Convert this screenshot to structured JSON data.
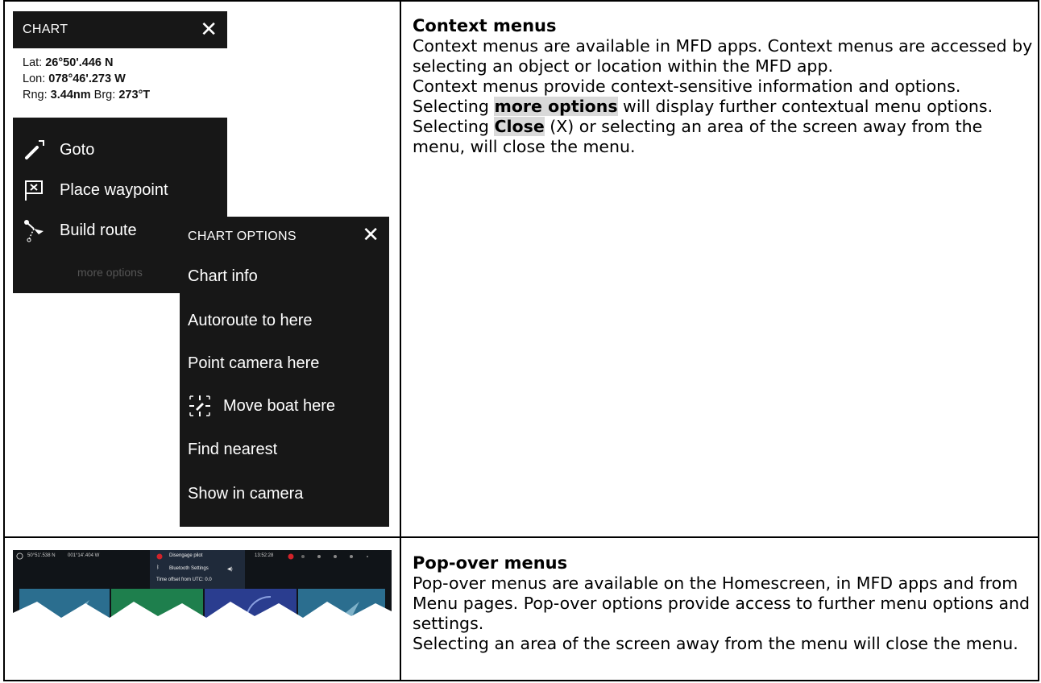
{
  "context_row": {
    "heading": "Context menus",
    "paragraphs": {
      "p1": "Context menus are available in MFD apps. Context menus are accessed by selecting an object or location within the MFD app.",
      "p2": "Context menus provide context-sensitive information and options.",
      "p3_a": "Selecting ",
      "p3_hl": "more options",
      "p3_b": " will display further contextual menu options.",
      "p4_a": "Selecting ",
      "p4_hl": "Close",
      "p4_b": " (X) or selecting an area of the screen away from the menu, will close the menu."
    }
  },
  "chart_menu": {
    "title": "CHART",
    "close": "✕",
    "lat_label": "Lat: ",
    "lat_value": "26°50'.446 N",
    "lon_label": "Lon: ",
    "lon_value": "078°46'.273 W",
    "rng_label": "Rng: ",
    "rng_value": "3.44nm",
    "brg_label": " Brg: ",
    "brg_value": "273°T",
    "items": {
      "goto": "Goto",
      "waypoint": "Place waypoint",
      "route": "Build route",
      "more": "more options"
    }
  },
  "options_menu": {
    "title": "CHART OPTIONS",
    "close": "✕",
    "items": {
      "i0": "Chart info",
      "i1": "Autoroute to here",
      "i2": "Point camera here",
      "i3": "Move boat here",
      "i4": "Find nearest",
      "i5": "Show in camera"
    }
  },
  "popover_row": {
    "heading": "Pop-over menus",
    "p1": "Pop-over menus are available on the Homescreen, in MFD apps and from Menu pages. Pop-over options provide access to further menu options and settings.",
    "p2": "Selecting an area of the screen away from the menu will close the menu."
  },
  "popover_screen": {
    "lat": "50°51'.538 N",
    "lon": "001°14'.404 W",
    "time": "13:52:28",
    "menu_item_1": "Disengage pilot",
    "menu_item_2": "Bluetooth Settings",
    "menu_item_3": "Time offset from UTC: 0.0"
  },
  "colors": {
    "menu_bg": "#171717",
    "highlight": "#d9d9d9",
    "pilot_red": "#d2232a"
  }
}
